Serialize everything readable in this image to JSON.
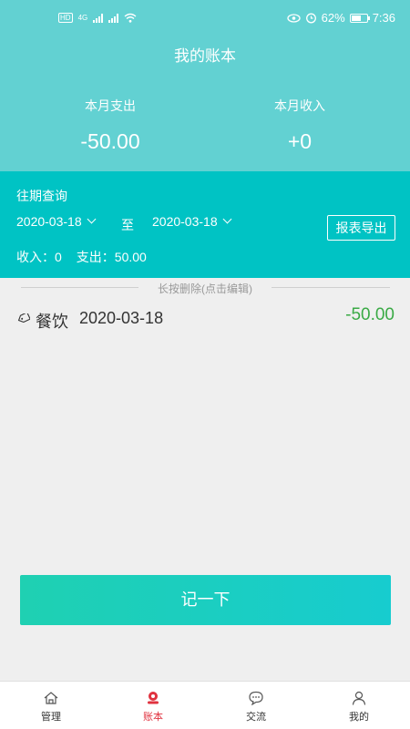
{
  "status_bar": {
    "network_badge": "HD",
    "sim_label": "4G",
    "battery": "62%",
    "battery_level": 0.62,
    "time": "7:36"
  },
  "header": {
    "title": "我的账本",
    "expense_label": "本月支出",
    "expense_value": "-50.00",
    "income_label": "本月收入",
    "income_value": "+0"
  },
  "query": {
    "title": "往期查询",
    "start_date": "2020-03-18",
    "to_label": "至",
    "end_date": "2020-03-18",
    "export_label": "报表导出",
    "income_total": "收入：0",
    "expense_total": "支出：50.00"
  },
  "hint": "长按删除(点击编辑)",
  "records": [
    {
      "category": "餐饮",
      "date": "2020-03-18",
      "amount": "-50.00",
      "icon": "tag-icon"
    }
  ],
  "record_button": "记一下",
  "tabs": [
    {
      "label": "管理",
      "icon": "home-icon"
    },
    {
      "label": "账本",
      "icon": "ledger-icon",
      "active": true
    },
    {
      "label": "交流",
      "icon": "chat-icon"
    },
    {
      "label": "我的",
      "icon": "user-icon"
    }
  ],
  "colors": {
    "header_bg": "#62d1d2",
    "query_bg": "#00c3c4",
    "amount_green": "#3aaa45",
    "active_tab": "#e0323f"
  }
}
